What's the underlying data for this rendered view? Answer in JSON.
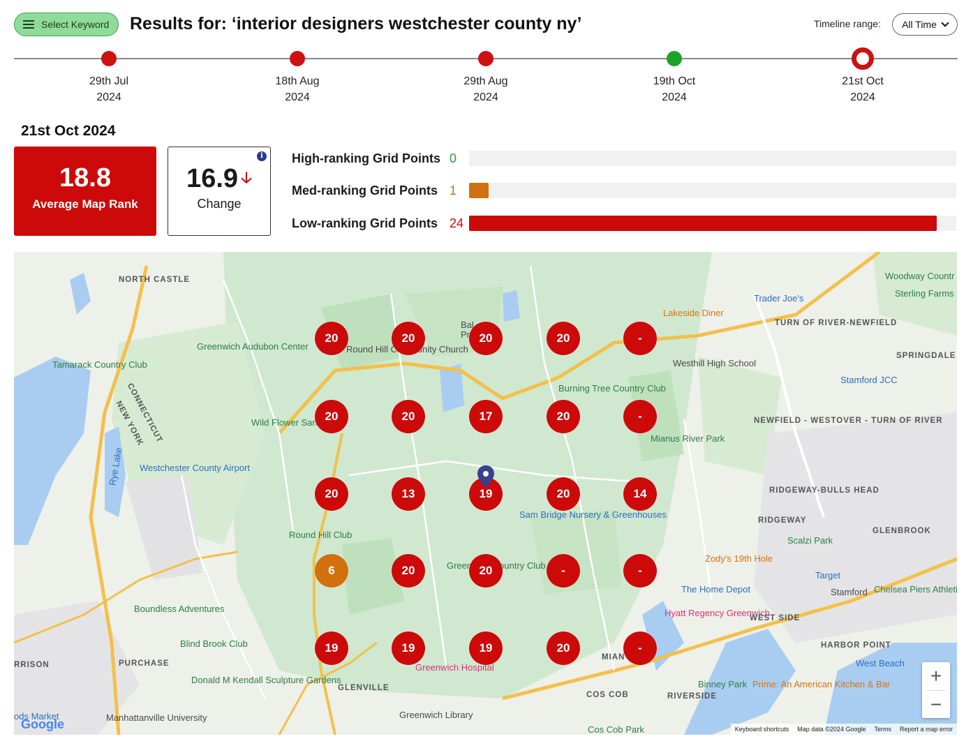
{
  "header": {
    "select_keyword_label": "Select Keyword",
    "title": "Results for: ‘interior designers westchester county ny’",
    "timeline_range_label": "Timeline range:",
    "timeline_range_value": "All Time"
  },
  "timeline": [
    {
      "line1": "29th Jul",
      "line2": "2024",
      "status": "red"
    },
    {
      "line1": "18th Aug",
      "line2": "2024",
      "status": "red"
    },
    {
      "line1": "29th Aug",
      "line2": "2024",
      "status": "red"
    },
    {
      "line1": "19th Oct",
      "line2": "2024",
      "status": "green"
    },
    {
      "line1": "21st Oct",
      "line2": "2024",
      "status": "active"
    }
  ],
  "selected_date": "21st Oct 2024",
  "summary": {
    "average_value": "18.8",
    "average_label": "Average Map Rank",
    "change_value": "16.9",
    "change_label": "Change",
    "info_symbol": "i"
  },
  "ranking": [
    {
      "label": "High-ranking Grid Points",
      "count": "0",
      "fraction": 0,
      "color": "#2e9a3c"
    },
    {
      "label": "Med-ranking Grid Points",
      "count": "1",
      "fraction": 0.04,
      "color": "#d1700c"
    },
    {
      "label": "Low-ranking Grid Points",
      "count": "24",
      "fraction": 0.96,
      "color": "#cc0a0a"
    }
  ],
  "grid": [
    [
      "20",
      "20",
      "20",
      "20",
      "-"
    ],
    [
      "20",
      "20",
      "17",
      "20",
      "-"
    ],
    [
      "20",
      "13",
      "19",
      "20",
      "14"
    ],
    [
      "6",
      "20",
      "20",
      "-",
      "-"
    ],
    [
      "19",
      "19",
      "19",
      "20",
      "-"
    ]
  ],
  "map_labels": {
    "north_castle": "NORTH CASTLE",
    "greenwich_audubon": "Greenwich Audubon Center",
    "tamarack": "Tamarack Country Club",
    "connecticut_ny_1": "CONNECTICUT",
    "connecticut_ny_2": "NEW YORK",
    "wild_flower": "Wild Flower Sanctuary",
    "westchester_airport": "Westchester County Airport",
    "rye_lake": "Rye Lake",
    "round_hill_church": "Round Hill Community Church",
    "round_hill_club": "Round Hill Club",
    "boundless": "Boundless Adventures",
    "blind_brook": "Blind Brook Club",
    "purchase": "PURCHASE",
    "donald_kendall": "Donald M Kendall Sculpture Gardens",
    "manhattanville": "Manhattanville University",
    "glenville": "GLENVILLE",
    "greenwich_hospital": "Greenwich Hospital",
    "greenwich_library": "Greenwich Library",
    "sam_bridge": "Sam Bridge Nursery & Greenhouses",
    "burning_tree": "Burning Tree Country Club",
    "green_cc": "Greenwich Country Club",
    "mianus": "Mianus River Park",
    "lakeside": "Lakeside Diner",
    "trader_joes": "Trader Joe's",
    "woodway": "Woodway Countr",
    "sterling": "Sterling Farms Golf Course",
    "turn_of_river": "TURN OF RIVER-NEWFIELD",
    "westhill": "Westhill High School",
    "springdale": "SPRINGDALE",
    "stamford_jcc": "Stamford JCC",
    "newfield": "NEWFIELD - WESTOVER - TURN OF RIVER",
    "ridgeway_bulls": "RIDGEWAY-BULLS HEAD",
    "ridgeway": "RIDGEWAY",
    "glenbrook": "GLENBROOK",
    "scalzi": "Scalzi Park",
    "zodys": "Zody's 19th Hole",
    "target": "Target",
    "home_depot": "The Home Depot",
    "stamford": "Stamford",
    "chelsea": "Chelsea Piers Athletic Club",
    "hyatt": "Hyatt Regency Greenwich",
    "west_side": "WEST SIDE",
    "harbor_point": "HARBOR POINT",
    "west_beach": "West Beach",
    "binney": "Binney Park",
    "prime": "Prime: An American Kitchen & Bar",
    "riverside": "RIVERSIDE",
    "cos_cob": "COS COB",
    "cos_cob_park": "Cos Cob Park",
    "harrison": "RRISON",
    "ods_market": "ods Market",
    "mian": "MIAN",
    "balance": "Bal Pr"
  },
  "map_controls": {
    "zoom_in": "+",
    "zoom_out": "−"
  },
  "attribution": {
    "google": "Google",
    "shortcuts": "Keyboard shortcuts",
    "map_data": "Map data ©2024 Google",
    "terms": "Terms",
    "report": "Report a map error"
  }
}
